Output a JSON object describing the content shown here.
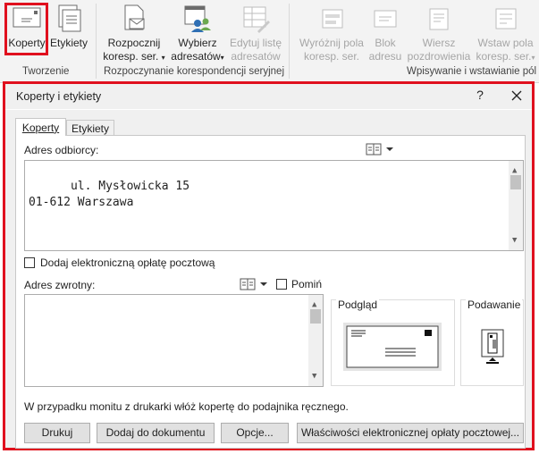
{
  "ribbon": {
    "groups": {
      "create": "Tworzenie",
      "mailmerge": "Rozpoczynanie korespondencji seryjnej",
      "insert": "Wpisywanie i wstawianie pól"
    },
    "buttons": {
      "envelopes": "Koperty",
      "labels": "Etykiety",
      "start_merge_1": "Rozpocznij",
      "start_merge_2": "koresp. ser.",
      "select_recipients_1": "Wybierz",
      "select_recipients_2": "adresatów",
      "edit_list_1": "Edytuj listę",
      "edit_list_2": "adresatów",
      "highlight_fields_1": "Wyróżnij pola",
      "highlight_fields_2": "koresp. ser.",
      "address_block_1": "Blok",
      "address_block_2": "adresu",
      "greeting_line_1": "Wiersz",
      "greeting_line_2": "pozdrowienia",
      "insert_field_1": "Wstaw pola",
      "insert_field_2": "koresp. ser."
    }
  },
  "dialog": {
    "title": "Koperty i etykiety",
    "help": "?",
    "tabs": {
      "envelopes": "Koperty",
      "labels": "Etykiety"
    },
    "delivery_label": "Adres odbiorcy:",
    "delivery_address": "ul. Mysłowicka 15\n01-612 Warszawa",
    "epostage_checkbox": "Dodaj elektroniczną opłatę pocztową",
    "return_label": "Adres zwrotny:",
    "omit_checkbox": "Pomiń",
    "return_address": "",
    "preview_label": "Podgląd",
    "feed_label": "Podawanie",
    "instruction": "W przypadku monitu z drukarki włóż kopertę do podajnika ręcznego.",
    "buttons": {
      "print": "Drukuj",
      "add_to_document": "Dodaj do dokumentu",
      "options": "Opcje...",
      "epostage_properties": "Właściwości elektronicznej opłaty pocztowej..."
    }
  }
}
